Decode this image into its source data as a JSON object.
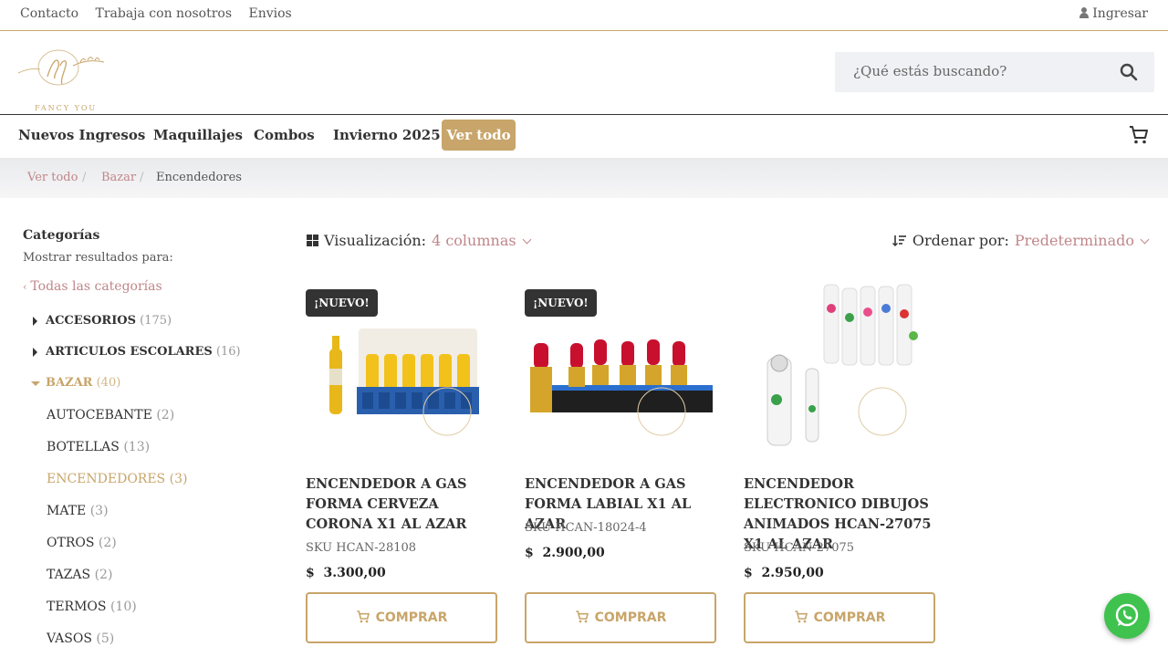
{
  "topbar": {
    "links": [
      "Contacto",
      "Trabaja con nosotros",
      "Envios"
    ],
    "login": "Ingresar"
  },
  "logo": {
    "text": "FANCY YOU"
  },
  "search": {
    "placeholder": "¿Qué estás buscando?"
  },
  "nav": {
    "items": [
      "Nuevos Ingresos",
      "Maquillajes",
      "Combos",
      "Invierno 2025"
    ],
    "button": "Ver todo"
  },
  "breadcrumb": {
    "items": [
      "Ver todo",
      "Bazar",
      "Encendedores"
    ],
    "separator": "/"
  },
  "sidebar": {
    "title": "Categorías",
    "subtitle": "Mostrar resultados para:",
    "all": "Todas las categorías",
    "categories": [
      {
        "name": "ACCESORIOS",
        "count": "(175)"
      },
      {
        "name": "ARTICULOS ESCOLARES",
        "count": "(16)"
      },
      {
        "name": "BAZAR",
        "count": "(40)"
      }
    ],
    "subcategories": [
      {
        "name": "AUTOCEBANTE",
        "count": "(2)"
      },
      {
        "name": "BOTELLAS",
        "count": "(13)"
      },
      {
        "name": "ENCENDEDORES",
        "count": "(3)"
      },
      {
        "name": "MATE",
        "count": "(3)"
      },
      {
        "name": "OTROS",
        "count": "(2)"
      },
      {
        "name": "TAZAS",
        "count": "(2)"
      },
      {
        "name": "TERMOS",
        "count": "(10)"
      },
      {
        "name": "VASOS",
        "count": "(5)"
      }
    ]
  },
  "toolbar": {
    "view_label": "Visualización:",
    "view_value": "4 columnas",
    "order_label": "Ordenar por:",
    "order_value": "Predeterminado"
  },
  "products": [
    {
      "badge": "¡NUEVO!",
      "name": "ENCENDEDOR A GAS FORMA CERVEZA CORONA X1 AL AZAR",
      "sku": "SKU HCAN-28108",
      "currency": "$",
      "price": "3.300,00",
      "button": "COMPRAR"
    },
    {
      "badge": "¡NUEVO!",
      "name": "ENCENDEDOR A GAS FORMA LABIAL X1 AL AZAR",
      "sku": "SKU HCAN-18024-4",
      "currency": "$",
      "price": "2.900,00",
      "button": "COMPRAR"
    },
    {
      "badge": "",
      "name": "ENCENDEDOR ELECTRONICO DIBUJOS ANIMADOS HCAN-27075 X1 AL AZAR",
      "sku": "SKU HCAN-27075",
      "currency": "$",
      "price": "2.950,00",
      "button": "COMPRAR"
    }
  ],
  "colors": {
    "accent": "#c8a56a",
    "link": "#c0868a",
    "whatsapp": "#3fc24e"
  }
}
